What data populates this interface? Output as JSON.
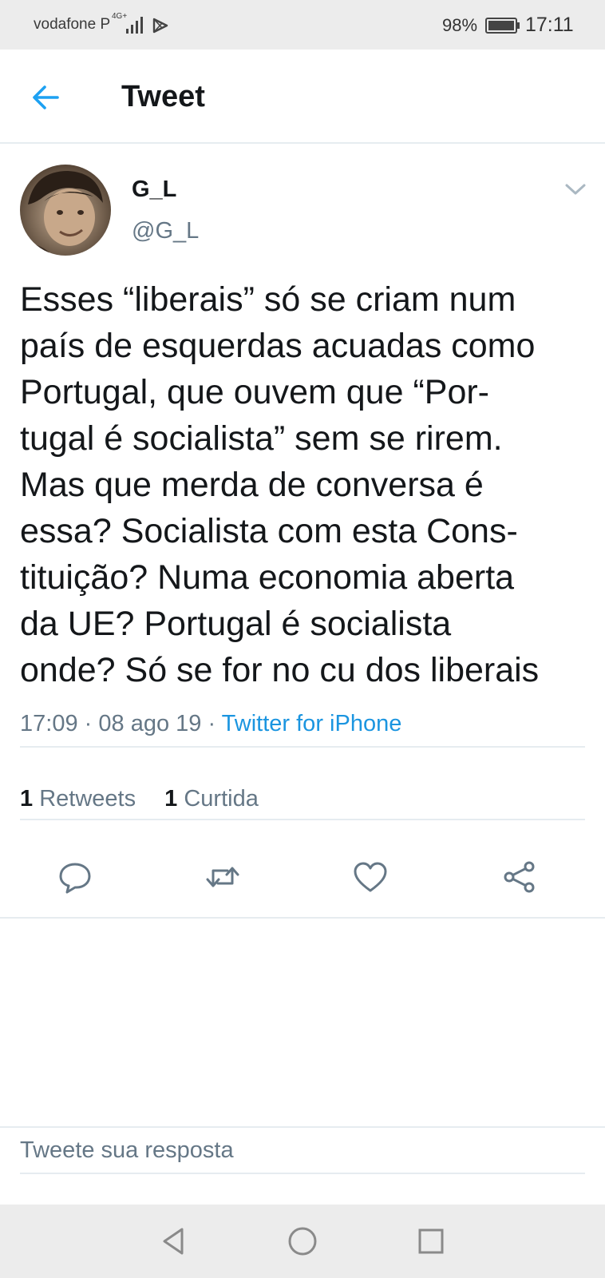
{
  "status_bar": {
    "carrier": "vodafone P",
    "network": "4G+",
    "battery": "98%",
    "time": "17:11"
  },
  "header": {
    "title": "Tweet",
    "back_icon": "arrow-left-icon"
  },
  "tweet": {
    "display_name": "G_L",
    "handle": "@G_L",
    "text_lines": [
      "Esses “liberais” só se criam num",
      "país de esquerdas acuadas como",
      "Portugal, que ouvem que “Por-",
      "tugal é socialista” sem se rirem.",
      "Mas que merda de conversa é",
      "essa? Socialista com esta Cons-",
      "tituição? Numa economia aberta",
      "da UE? Portugal é socialista",
      "onde? Só se for no cu dos liberais"
    ],
    "time": "17:09",
    "date": "08 ago 19",
    "separator": "·",
    "source": "Twitter for iPhone",
    "retweets_count": "1",
    "retweets_label": "Retweets",
    "likes_count": "1",
    "likes_label": "Curtida"
  },
  "actions": [
    "reply-icon",
    "retweet-icon",
    "heart-icon",
    "share-icon"
  ],
  "reply": {
    "placeholder": "Tweete sua resposta"
  },
  "colors": {
    "accent": "#1b95e0",
    "secondary_text": "#657786",
    "divider": "#e6ecf0",
    "system_bar": "#ececec"
  }
}
